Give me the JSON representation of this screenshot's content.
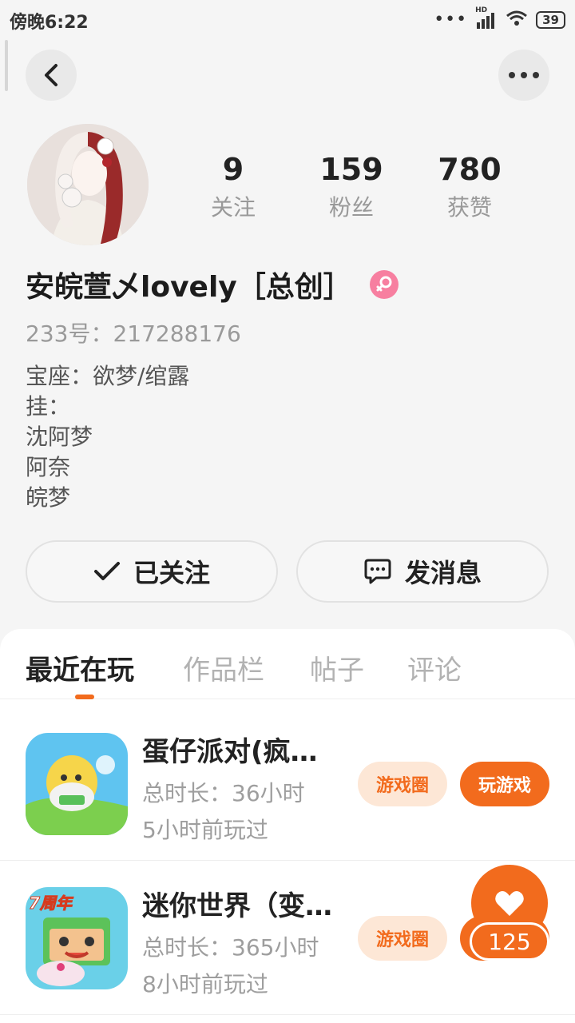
{
  "status_bar": {
    "time": "傍晚6:22",
    "signal_label": "HD",
    "battery": "39"
  },
  "profile": {
    "name": "安皖萱乄lovely［总创］",
    "id_text": "233号：217288176",
    "bio_lines": [
      "宝座：欲梦/绾露",
      "挂：",
      "沈阿梦",
      "阿奈",
      "皖梦"
    ]
  },
  "stats": {
    "following": {
      "value": "9",
      "label": "关注"
    },
    "followers": {
      "value": "159",
      "label": "粉丝"
    },
    "likes": {
      "value": "780",
      "label": "获赞"
    }
  },
  "actions": {
    "follow_label": "已关注",
    "message_label": "发消息"
  },
  "tabs": [
    "最近在玩",
    "作品栏",
    "帖子",
    "评论"
  ],
  "games": [
    {
      "title": "蛋仔派对(疯…",
      "duration": "总时长：36小时",
      "last_played": "5小时前玩过",
      "circle_label": "游戏圈",
      "play_label": "玩游戏"
    },
    {
      "title": "迷你世界（变…",
      "duration": "总时长：365小时",
      "last_played": "8小时前玩过",
      "circle_label": "游戏圈",
      "play_label": "",
      "icon_badge": "7周年"
    }
  ],
  "like_widget": {
    "count": "125"
  },
  "colors": {
    "accent": "#f26b1d",
    "gender_badge": "#f77fa0"
  }
}
